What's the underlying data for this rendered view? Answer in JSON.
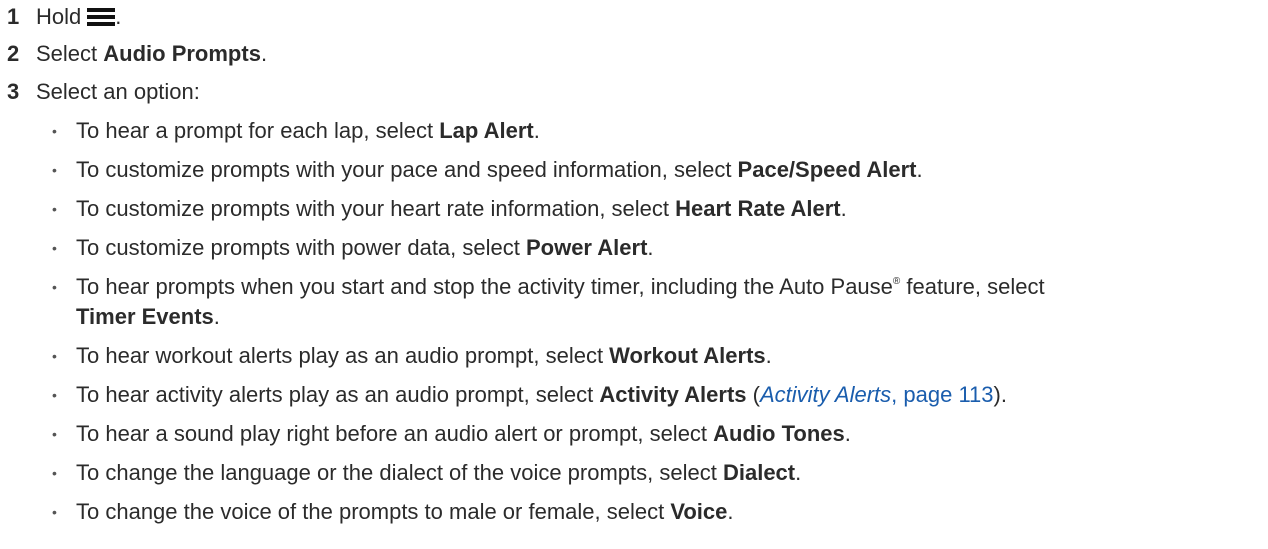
{
  "steps": [
    {
      "num": "1",
      "pre": "Hold",
      "icon": "menu-icon",
      "post": "."
    },
    {
      "num": "2",
      "pre": "Select ",
      "bold": "Audio Prompts",
      "post": "."
    },
    {
      "num": "3",
      "text": "Select an option:"
    }
  ],
  "options": [
    {
      "pre": "To hear a prompt for each lap, select ",
      "bold": "Lap Alert",
      "post": "."
    },
    {
      "pre": "To customize prompts with your pace and speed information, select ",
      "bold": "Pace/Speed Alert",
      "post": "."
    },
    {
      "pre": "To customize prompts with your heart rate information, select ",
      "bold": "Heart Rate Alert",
      "post": "."
    },
    {
      "pre": "To customize prompts with power data, select ",
      "bold": "Power Alert",
      "post": "."
    },
    {
      "pre": "To hear prompts when you start and stop the activity timer, including the Auto Pause",
      "sup": "®",
      "mid": " feature, select",
      "bold": "Timer Events",
      "post": "."
    },
    {
      "pre": "To hear workout alerts play as an audio prompt, select ",
      "bold": "Workout Alerts",
      "post": "."
    },
    {
      "pre": "To hear activity alerts play as an audio prompt, select ",
      "bold": "Activity Alerts",
      "post_open": " (",
      "xref_title": "Activity Alerts",
      "xref_page": ", page 113",
      "post": ")."
    },
    {
      "pre": "To hear a sound play right before an audio alert or prompt, select ",
      "bold": "Audio Tones",
      "post": "."
    },
    {
      "pre": "To change the language or the dialect of the voice prompts, select ",
      "bold": "Dialect",
      "post": "."
    },
    {
      "pre": "To change the voice of the prompts to male or female, select ",
      "bold": "Voice",
      "post": "."
    }
  ],
  "bullet_char": "•",
  "colors": {
    "text": "#2b2b2b",
    "link": "#1a5dad"
  }
}
